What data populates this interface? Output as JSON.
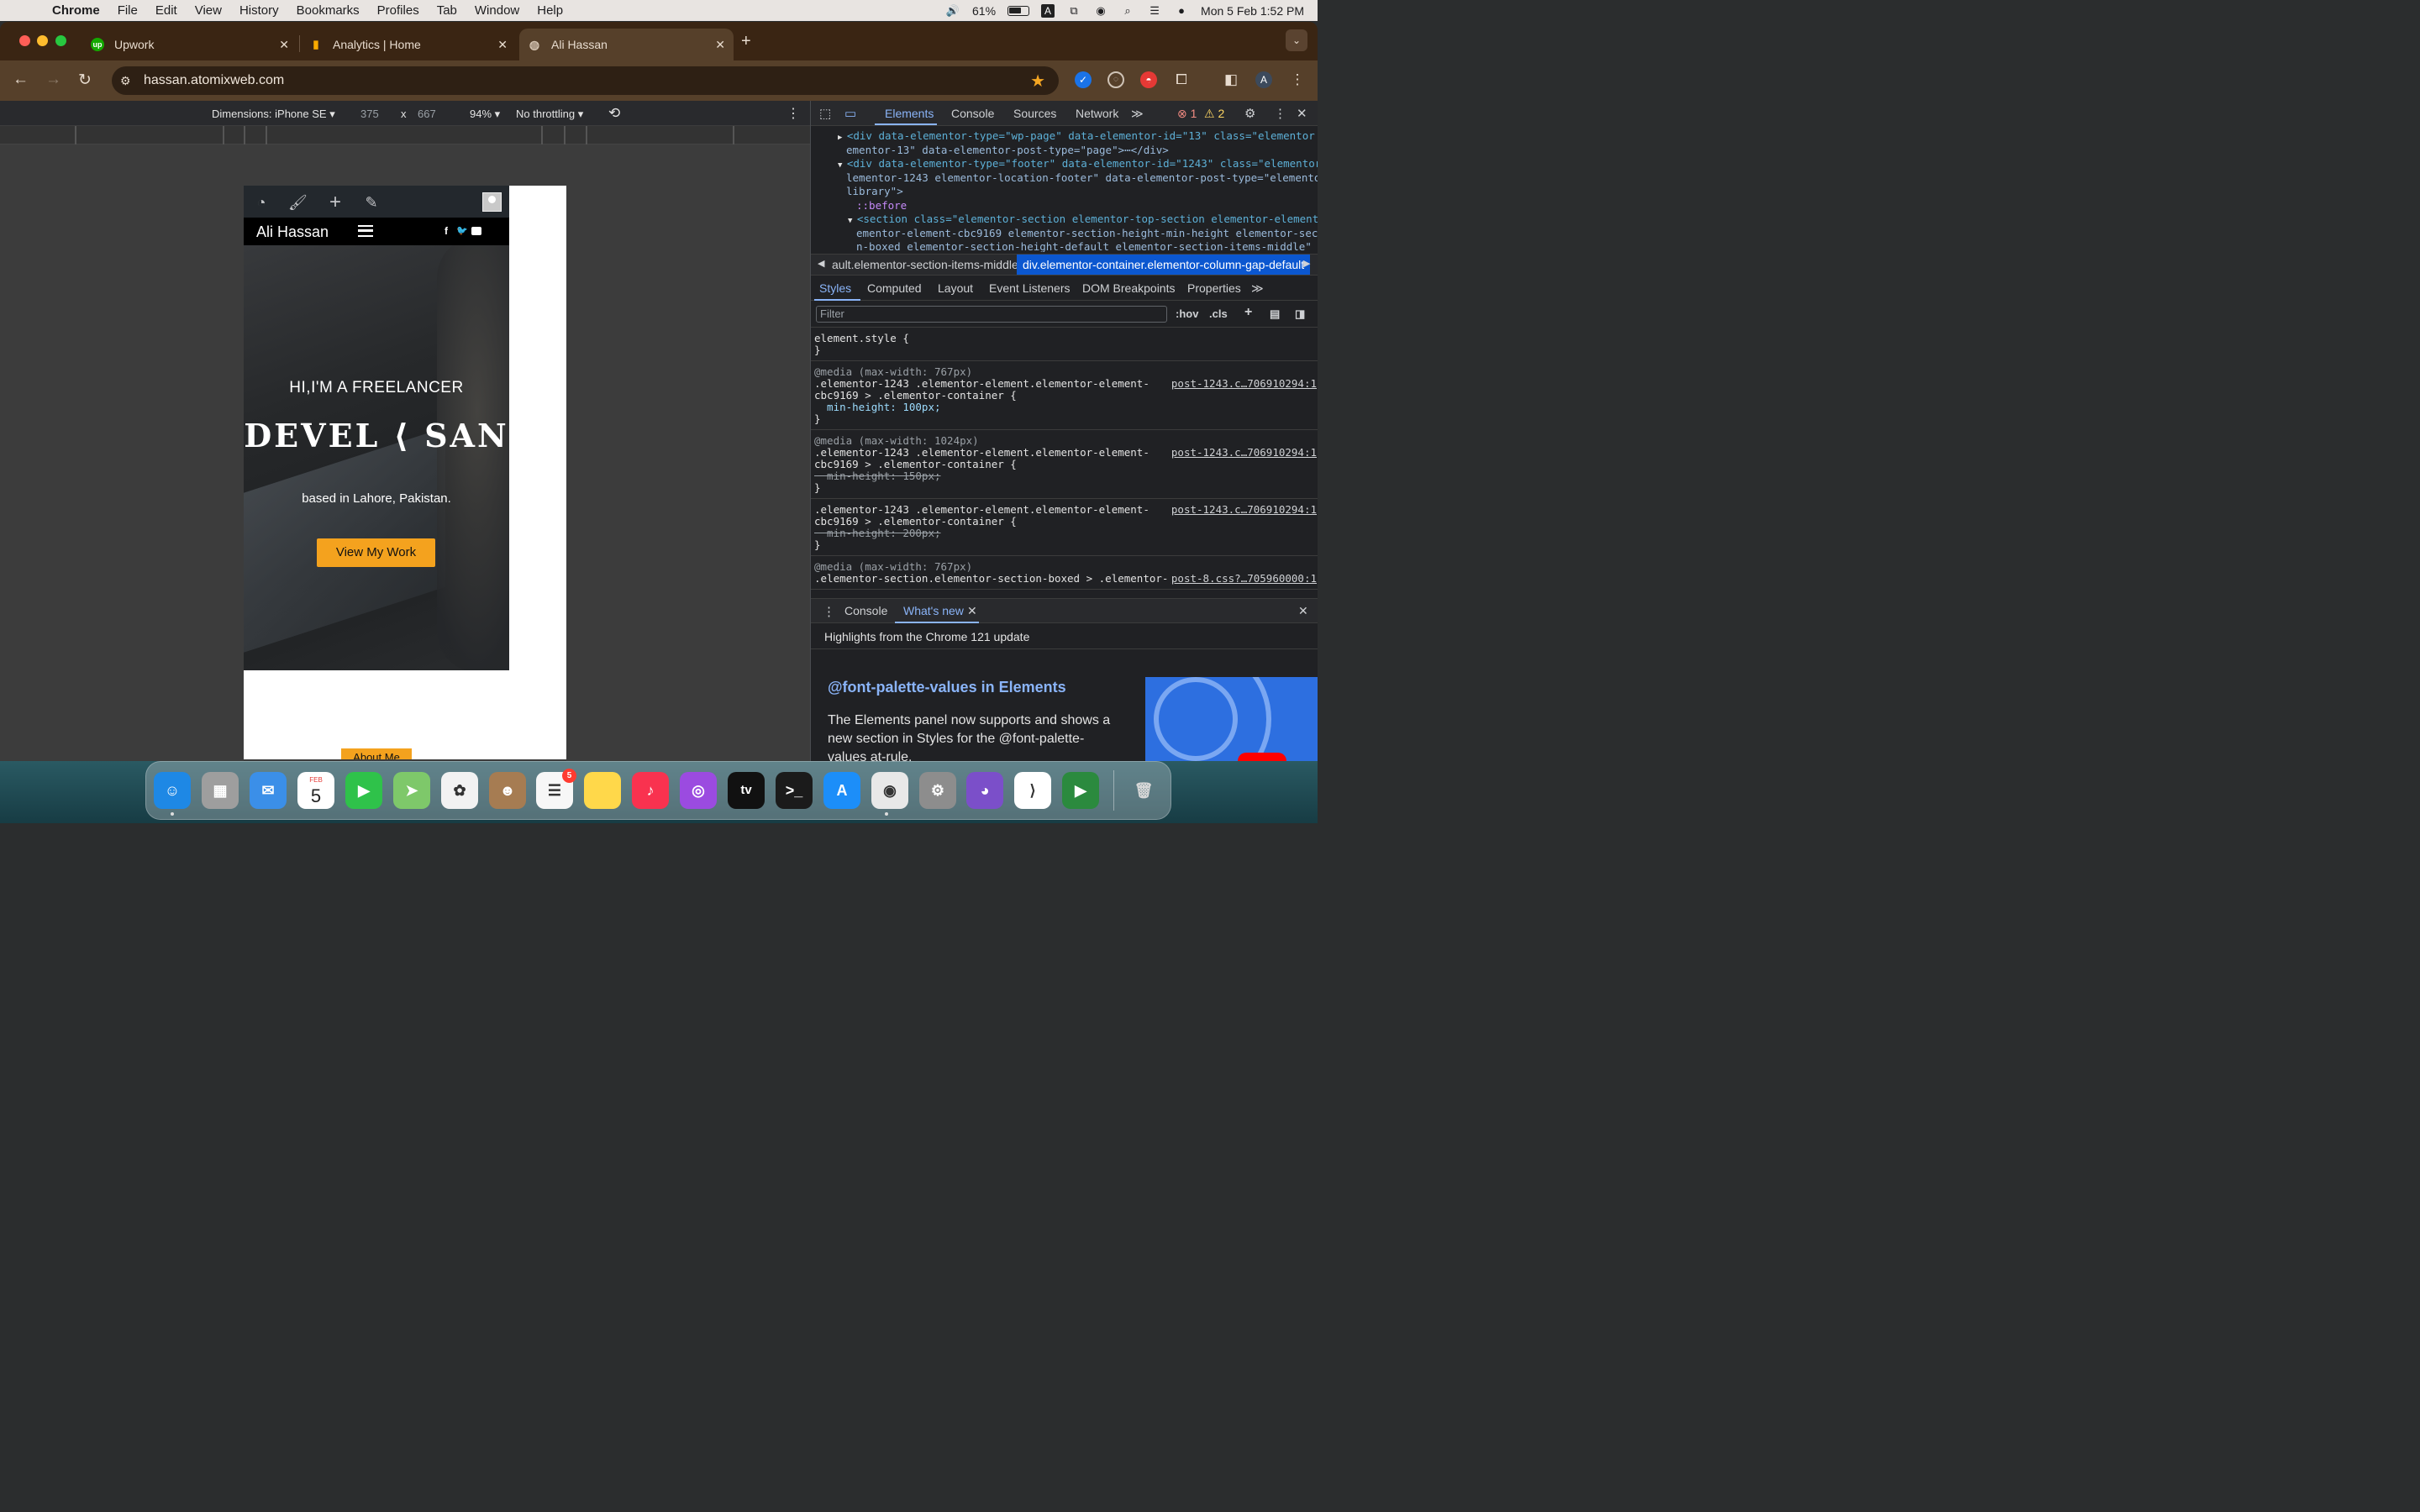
{
  "menubar": {
    "app": "Chrome",
    "menus": [
      "File",
      "Edit",
      "View",
      "History",
      "Bookmarks",
      "Profiles",
      "Tab",
      "Window",
      "Help"
    ],
    "battery": "61%",
    "input_source": "A",
    "datetime": "Mon 5 Feb  1:52 PM"
  },
  "tabs": [
    {
      "title": "Upwork",
      "icon": "upwork-icon"
    },
    {
      "title": "Analytics | Home",
      "icon": "analytics-icon"
    },
    {
      "title": "Ali Hassan",
      "icon": "globe-icon",
      "active": true
    }
  ],
  "omnibox": {
    "url": "hassan.atomixweb.com"
  },
  "profile_initial": "A",
  "device_toolbar": {
    "dimensions": "Dimensions: iPhone SE",
    "width": "375",
    "times": "x",
    "height": "667",
    "zoom": "94%",
    "throttling": "No throttling"
  },
  "page": {
    "site_name": "Ali Hassan",
    "social": [
      "f",
      "t",
      "yt"
    ],
    "hero_sub": "HI,I'M A FREELANCER",
    "hero_big": "DEVEL ⟨ SAN",
    "hero_location": "based in Lahore, Pakistan.",
    "cta": "View My Work",
    "about": "About Me"
  },
  "devtools": {
    "tabs": [
      "Elements",
      "Console",
      "Sources",
      "Network"
    ],
    "errors": "1",
    "warnings": "2",
    "dom": [
      {
        "indent": 0,
        "arrow": "▶",
        "html": "<div data-elementor-type=\"wp-page\" data-elementor-id=\"13\" class=\"elementor el"
      },
      {
        "indent": 0,
        "arrow": "",
        "html": "ementor-13\" data-elementor-post-type=\"page\">⋯</div>"
      },
      {
        "indent": 0,
        "arrow": "▼",
        "html": "<div data-elementor-type=\"footer\" data-elementor-id=\"1243\" class=\"elementor e"
      },
      {
        "indent": 0,
        "arrow": "",
        "html": "lementor-1243 elementor-location-footer\" data-elementor-post-type=\"elementor_"
      },
      {
        "indent": 0,
        "arrow": "",
        "html": "library\">"
      },
      {
        "indent": 1,
        "arrow": "",
        "html": "::before"
      },
      {
        "indent": 1,
        "arrow": "▼",
        "html": "<section class=\"elementor-section elementor-top-section elementor-element el"
      },
      {
        "indent": 1,
        "arrow": "",
        "html": "ementor-element-cbc9169 elementor-section-height-min-height elementor-sectio"
      },
      {
        "indent": 1,
        "arrow": "",
        "html": "n-boxed elementor-section-height-default elementor-section-items-middle\""
      }
    ],
    "breadcrumb_prev": "ault.elementor-section-items-middle",
    "breadcrumb_current": "div.elementor-container.elementor-column-gap-default",
    "subtabs": [
      "Styles",
      "Computed",
      "Layout",
      "Event Listeners",
      "DOM Breakpoints",
      "Properties"
    ],
    "filter_placeholder": "Filter",
    "filter_opts": [
      ":hov",
      ".cls"
    ],
    "rules": [
      {
        "lines": [
          "element.style {",
          "}"
        ],
        "src": ""
      },
      {
        "lines": [
          "@media (max-width: 767px)",
          ".elementor-1243 .elementor-element.elementor-element-",
          "cbc9169 > .elementor-container {",
          "  min-height: 100px;",
          "}"
        ],
        "src": "post-1243.c…706910294:1"
      },
      {
        "lines": [
          "@media (max-width: 1024px)",
          ".elementor-1243 .elementor-element.elementor-element-",
          "cbc9169 > .elementor-container {",
          "  min-height: 150px;",
          "}"
        ],
        "src": "post-1243.c…706910294:1"
      },
      {
        "lines": [
          ".elementor-1243 .elementor-element.elementor-element-",
          "cbc9169 > .elementor-container {",
          "  min-height: 200px;",
          "}"
        ],
        "src": "post-1243.c…706910294:1"
      },
      {
        "lines": [
          "@media (max-width: 767px)",
          ".elementor-section.elementor-section-boxed > .elementor-"
        ],
        "src": "post-8.css?…705960000:1"
      }
    ],
    "drawer_tabs": [
      "Console",
      "What's new"
    ],
    "whatsnew_head": "Highlights from the Chrome 121 update",
    "whatsnew_title": "@font-palette-values in Elements",
    "whatsnew_body": "The Elements panel now supports and shows a new section in Styles for the @font-palette-values at-rule."
  },
  "dock": {
    "apps": [
      "Finder",
      "Launchpad",
      "Mail",
      "Calendar",
      "FaceTime",
      "Maps",
      "Photos",
      "Contacts",
      "Reminders",
      "Notes",
      "Music",
      "Podcasts",
      "TV",
      "Terminal",
      "App Store",
      "Chrome",
      "System Settings",
      "GitHub Desktop",
      "VS Code",
      "Meet"
    ],
    "calendar_month": "FEB",
    "calendar_day": "5",
    "reminders_badge": "5",
    "tv_label": "tv"
  }
}
